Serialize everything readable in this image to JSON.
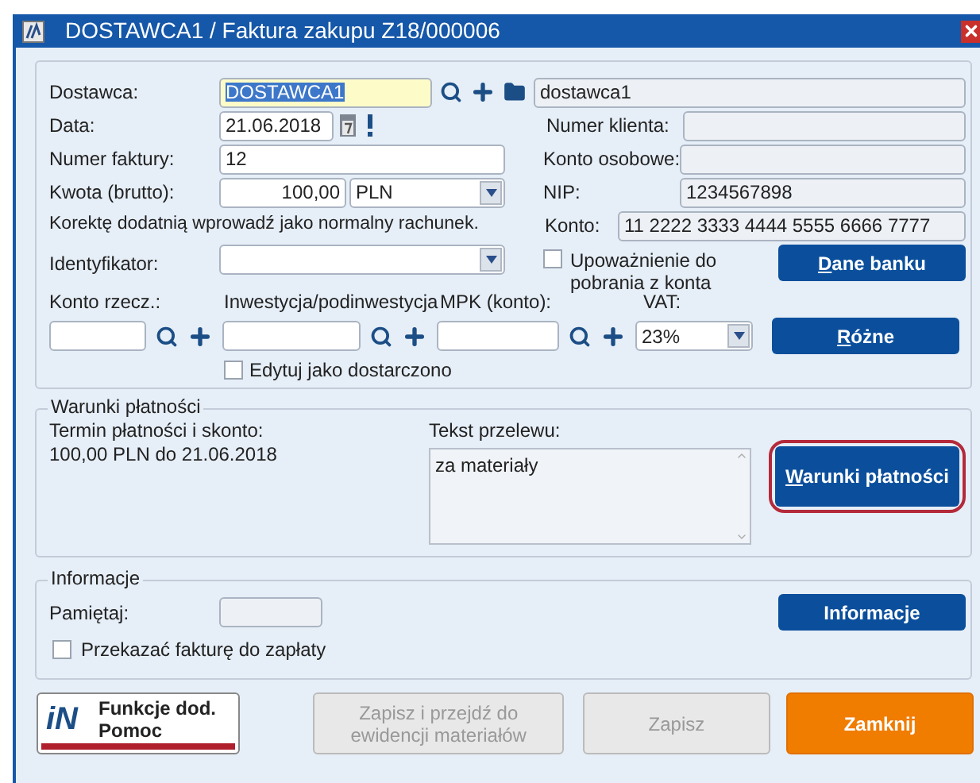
{
  "window": {
    "title": "DOSTAWCA1 / Faktura zakupu Z18/000006"
  },
  "supplier": {
    "label": "Dostawca:",
    "code": "DOSTAWCA1",
    "code_selected": true,
    "name": "dostawca1"
  },
  "date": {
    "label": "Data:",
    "value": "21.06.2018"
  },
  "invoice_number": {
    "label": "Numer faktury:",
    "value": "12"
  },
  "amount": {
    "label": "Kwota (brutto):",
    "value": "100,00",
    "currency": "PLN"
  },
  "right_fields": [
    {
      "label": "Numer klienta:",
      "readonly": true
    },
    {
      "label": "Konto osobowe:",
      "readonly": true
    },
    {
      "label": "NIP:",
      "value": "1234567898",
      "readonly": true
    }
  ],
  "correction_note": "Korektę dodatnią wprowadź jako normalny rachunek.",
  "konto": {
    "label": "Konto:",
    "value": "11 2222 3333 4444 5555 6666 7777"
  },
  "identifier": {
    "label": "Identyfikator:"
  },
  "authorization": {
    "label": "Upoważnienie do pobrania z konta",
    "checked": false
  },
  "bank_button": {
    "label": "Dane banku",
    "first_letter_underlined": true
  },
  "lookup_fields": [
    {
      "label": "Konto rzecz.:"
    },
    {
      "label": "Inwestycja/podinwestycja"
    },
    {
      "label": "MPK (konto):"
    }
  ],
  "vat": {
    "label": "VAT:",
    "value": "23%"
  },
  "misc_button": {
    "label": "Różne",
    "first_letter_underlined": true
  },
  "edit_delivered": {
    "label": "Edytuj jako dostarczono",
    "checked": false
  },
  "payment": {
    "legend": "Warunki płatności",
    "terms_label": "Termin płatności i skonto:",
    "terms_value": "100,00 PLN do 21.06.2018",
    "transfer_label": "Tekst przelewu:",
    "transfer_text": "za materiały",
    "button": {
      "label": "Warunki płatności",
      "first_letter_underlined": true,
      "highlighted": true
    }
  },
  "info": {
    "legend": "Informacje",
    "remember_label": "Pamiętaj:",
    "button": {
      "label": "Informacje"
    },
    "pass_invoice": {
      "label": "Przekazać fakturę do zapłaty",
      "checked": false
    }
  },
  "footer": {
    "help": {
      "logo": "iN",
      "lines": [
        "Funkcje dod.",
        "Pomoc"
      ]
    },
    "buttons": [
      {
        "label": "Zapisz i przejdź do ewidencji materiałów",
        "kind": "secondary",
        "disabled": true
      },
      {
        "label": "Zapisz",
        "kind": "secondary",
        "disabled": true
      },
      {
        "label": "Zamknij",
        "kind": "primary",
        "disabled": false
      }
    ]
  }
}
